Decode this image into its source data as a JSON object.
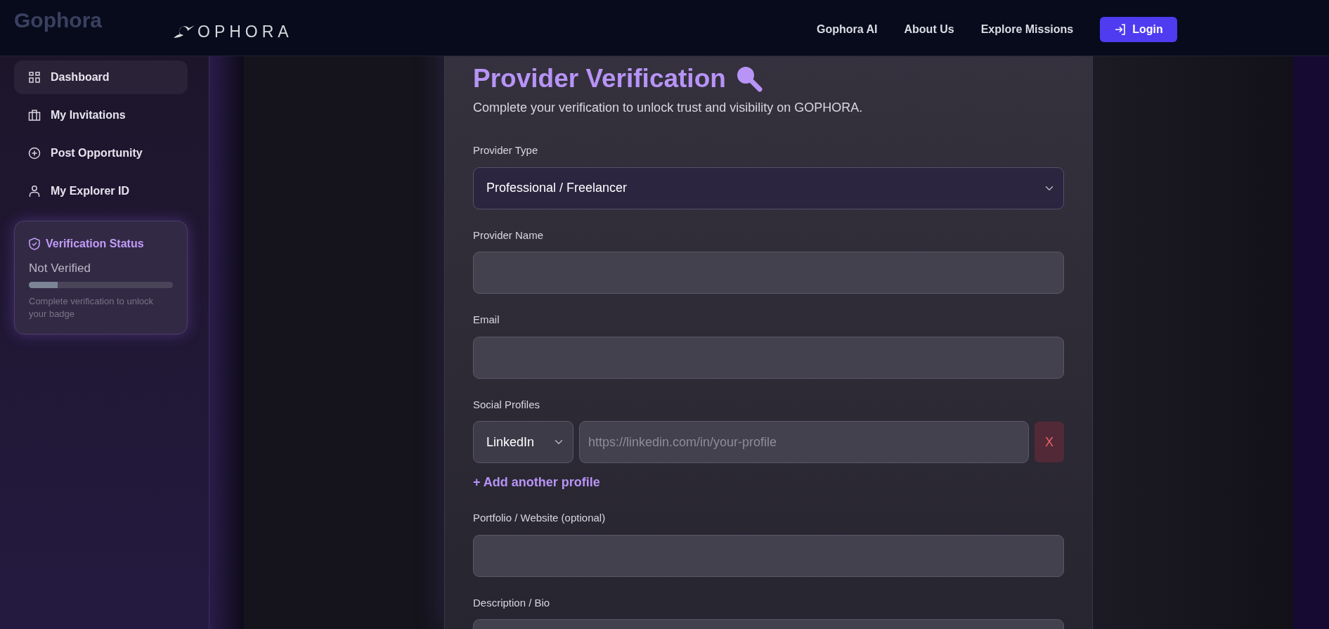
{
  "ghost_brand": "Gophora",
  "navbar": {
    "logo": "OPHORA",
    "links": [
      "Gophora AI",
      "About Us",
      "Explore Missions"
    ],
    "login": "Login"
  },
  "sidebar": {
    "items": [
      {
        "label": "Dashboard",
        "selected": true
      },
      {
        "label": "My Invitations",
        "selected": false
      },
      {
        "label": "Post Opportunity",
        "selected": false
      },
      {
        "label": "My Explorer ID",
        "selected": false
      }
    ],
    "verification": {
      "title": "Verification Status",
      "status": "Not Verified",
      "level": 0.2,
      "hint": "Complete verification to unlock your badge"
    }
  },
  "form": {
    "title": "Provider Verification",
    "subtitle": "Complete your verification to unlock trust and visibility on GOPHORA.",
    "fields": [
      {
        "kind": "select",
        "label": "Provider Type",
        "value": "Professional / Freelancer"
      },
      {
        "kind": "input",
        "label": "Provider Name"
      },
      {
        "kind": "input",
        "label": "Email"
      },
      {
        "kind": "social",
        "label": "Social Profiles",
        "profiles": [
          {
            "platform": "LinkedIn",
            "placeholder": "https://linkedin.com/in/your-profile",
            "remove": "X"
          }
        ],
        "add_link": "+ Add another profile"
      },
      {
        "kind": "input",
        "label": "Portfolio / Website (optional)"
      },
      {
        "kind": "textarea",
        "label": "Description / Bio"
      }
    ]
  }
}
